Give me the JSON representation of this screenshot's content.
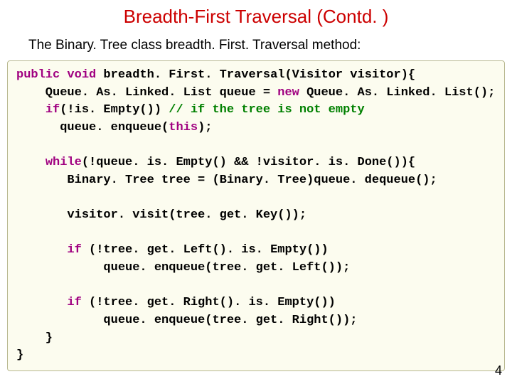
{
  "title": "Breadth-First Traversal (Contd. )",
  "subtitle": "The Binary. Tree class breadth. First. Traversal method:",
  "code": {
    "l1a": "public",
    "l1b": " ",
    "l1c": "void",
    "l1d": " breadth. First. Traversal(Visitor visitor){",
    "l2": "    Queue. As. Linked. List queue = ",
    "l2b": "new",
    "l2c": " Queue. As. Linked. List();",
    "l3a": "    ",
    "l3b": "if",
    "l3c": "(!is. Empty()) ",
    "l3d": "// if the tree is not empty",
    "l4": "      queue. enqueue(",
    "l4b": "this",
    "l4c": ");",
    "blank1": " ",
    "l5a": "    ",
    "l5b": "while",
    "l5c": "(!queue. is. Empty() && !visitor. is. Done()){",
    "l6": "       Binary. Tree tree = (Binary. Tree)queue. dequeue();",
    "blank2": " ",
    "l7": "       visitor. visit(tree. get. Key());",
    "blank3": " ",
    "l8a": "       ",
    "l8b": "if",
    "l8c": " (!tree. get. Left(). is. Empty())",
    "l9": "            queue. enqueue(tree. get. Left());",
    "blank4": " ",
    "l10a": "       ",
    "l10b": "if",
    "l10c": " (!tree. get. Right(). is. Empty())",
    "l11": "            queue. enqueue(tree. get. Right());",
    "l12": "    }",
    "l13": "}"
  },
  "page_number": "4"
}
